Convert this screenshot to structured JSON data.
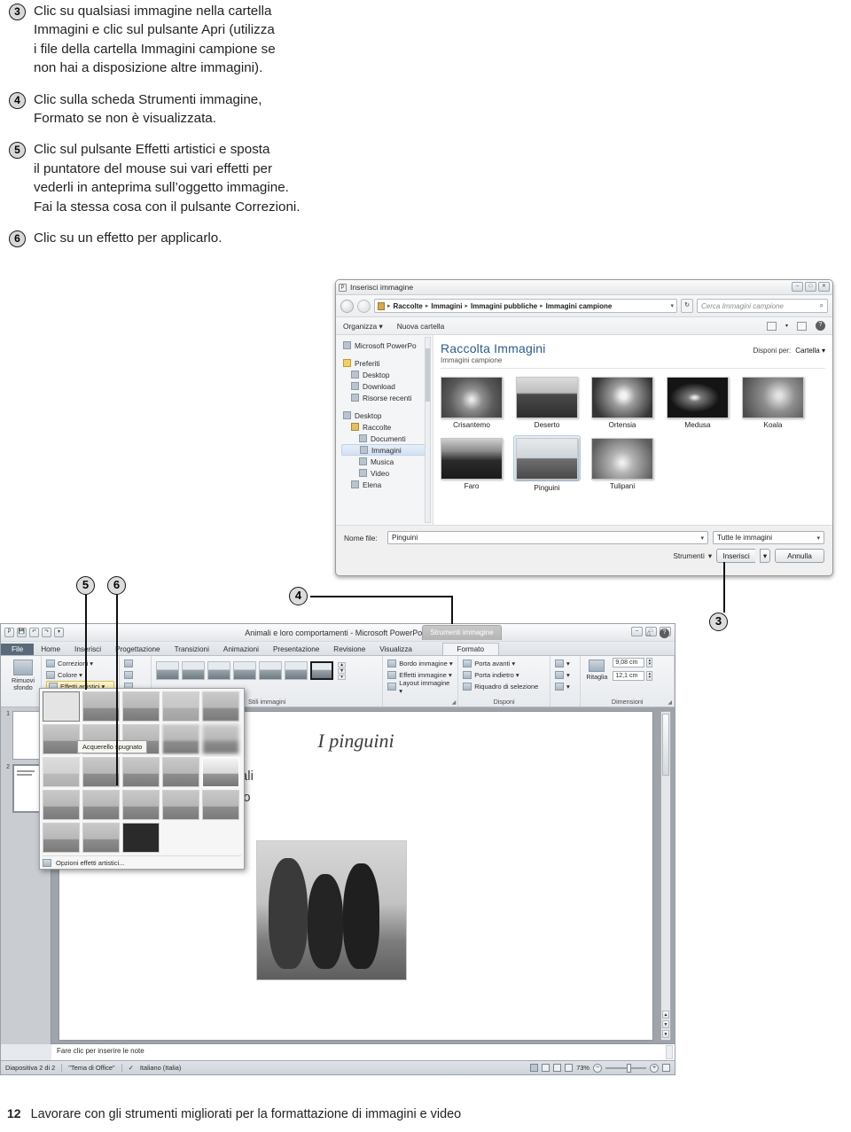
{
  "instructions": [
    {
      "num": "3",
      "lines": [
        "Clic su qualsiasi immagine nella cartella",
        "Immagini e clic sul pulsante Apri (utilizza",
        "i file della cartella Immagini campione se",
        "non hai a disposizione altre immagini)."
      ]
    },
    {
      "num": "4",
      "lines": [
        "Clic sulla scheda Strumenti immagine,",
        "Formato se non è visualizzata."
      ]
    },
    {
      "num": "5",
      "lines": [
        "Clic sul pulsante Effetti artistici e sposta",
        "il puntatore del mouse sui vari effetti per",
        "vederli in anteprima sull’oggetto immagine.",
        "Fai la stessa cosa con il pulsante Correzioni."
      ]
    },
    {
      "num": "6",
      "lines": [
        "Clic su un effetto per applicarlo."
      ]
    }
  ],
  "callouts": {
    "three": "3",
    "four": "4",
    "five": "5",
    "six": "6"
  },
  "dialog": {
    "title": "Inserisci immagine",
    "app_badge": "P",
    "window_buttons": {
      "minimize": "–",
      "maximize": "□",
      "close": "✕"
    },
    "breadcrumb": {
      "separator": "▸",
      "parts": [
        "Raccolte",
        "Immagini",
        "Immagini pubbliche",
        "Immagini campione"
      ],
      "caret": "▾"
    },
    "refresh_label": "↻",
    "search_placeholder": "Cerca Immagini campione",
    "search_icon": "⌕",
    "commandbar": {
      "organize": "Organizza ▾",
      "new_folder": "Nuova cartella",
      "help": "?"
    },
    "nav_items": [
      {
        "label": "Microsoft PowerPo",
        "icon": "app-icon",
        "indent": 0,
        "selected": false,
        "gap": false
      },
      {
        "label": "Preferiti",
        "icon": "star-icon",
        "indent": 0,
        "selected": false,
        "gap": true
      },
      {
        "label": "Desktop",
        "icon": "desktop-icon",
        "indent": 1,
        "selected": false,
        "gap": false
      },
      {
        "label": "Download",
        "icon": "download-icon",
        "indent": 1,
        "selected": false,
        "gap": false
      },
      {
        "label": "Risorse recenti",
        "icon": "recent-icon",
        "indent": 1,
        "selected": false,
        "gap": false
      },
      {
        "label": "Desktop",
        "icon": "desktop-icon",
        "indent": 0,
        "selected": false,
        "gap": true
      },
      {
        "label": "Raccolte",
        "icon": "library-icon",
        "indent": 1,
        "selected": false,
        "gap": false
      },
      {
        "label": "Documenti",
        "icon": "documents-icon",
        "indent": 2,
        "selected": false,
        "gap": false
      },
      {
        "label": "Immagini",
        "icon": "pictures-icon",
        "indent": 2,
        "selected": true,
        "gap": false
      },
      {
        "label": "Musica",
        "icon": "music-icon",
        "indent": 2,
        "selected": false,
        "gap": false
      },
      {
        "label": "Video",
        "icon": "video-icon",
        "indent": 2,
        "selected": false,
        "gap": false
      },
      {
        "label": "Elena",
        "icon": "user-icon",
        "indent": 1,
        "selected": false,
        "gap": false
      }
    ],
    "library": {
      "title": "Raccolta Immagini",
      "subtitle": "Immagini campione",
      "arrange_label": "Disponi per:",
      "arrange_value": "Cartella ▾"
    },
    "files": [
      {
        "name": "Crisantemo",
        "selected": false
      },
      {
        "name": "Deserto",
        "selected": false
      },
      {
        "name": "Ortensia",
        "selected": false
      },
      {
        "name": "Medusa",
        "selected": false
      },
      {
        "name": "Koala",
        "selected": false
      },
      {
        "name": "Faro",
        "selected": false
      },
      {
        "name": "Pinguini",
        "selected": true
      },
      {
        "name": "Tulipani",
        "selected": false
      }
    ],
    "footer": {
      "filename_label": "Nome file:",
      "filename_value": "Pinguini",
      "filetype_value": "Tutte le immagini",
      "tools_label": "Strumenti",
      "insert_label": "Inserisci",
      "cancel_label": "Annulla",
      "caret": "▾"
    }
  },
  "powerpoint": {
    "document_title": "Animali e loro comportamenti - Microsoft PowerPoint",
    "app_badge": "P",
    "quick_access": [
      "save-icon",
      "undo-icon",
      "redo-icon",
      "customize-icon"
    ],
    "window_buttons": {
      "minimize": "–",
      "restore": "□",
      "close": "✕"
    },
    "contextual_tab_title": "Strumenti immagine",
    "tabs": [
      "File",
      "Home",
      "Inserisci",
      "Progettazione",
      "Transizioni",
      "Animazioni",
      "Presentazione",
      "Revisione",
      "Visualizza"
    ],
    "contextual_tab": "Formato",
    "ribbon": {
      "remove_background": [
        "Rimuovi",
        "sfondo"
      ],
      "adjust_buttons": [
        "Correzioni ▾",
        "Colore ▾",
        "Effetti artistici ▾"
      ],
      "styles_group": "Stili immagini",
      "style_count": 7,
      "selected_style": 6,
      "picture_commands": [
        "Bordo immagine ▾",
        "Effetti immagine ▾",
        "Layout immagine ▾"
      ],
      "arrange_commands": [
        "Porta avanti ▾",
        "Porta indietro ▾",
        "Riquadro di selezione"
      ],
      "arrange_group": "Disponi",
      "crop_label": "Ritaglia",
      "height_value": "9,08 cm",
      "width_value": "12,1 cm",
      "size_group": "Dimensioni"
    },
    "artistic_gallery": {
      "rows": [
        5,
        5,
        5,
        5,
        3
      ],
      "selected_index": 0,
      "hover_index": 11,
      "tooltip": "Acquerello spugnato",
      "options_label": "Opzioni effetti artistici..."
    },
    "slide": {
      "title": "I pinguini",
      "bullet_1": "portamenti individuali",
      "bullet_2": "portamenti di gruppo"
    },
    "slides_panel": [
      {
        "number": "1",
        "selected": false
      },
      {
        "number": "2",
        "selected": true
      }
    ],
    "notes_placeholder": "Fare clic per inserire le note",
    "status": {
      "slide_counter": "Diapositiva 2 di 2",
      "theme": "\"Tema di Office\"",
      "language": "Italiano (Italia)",
      "zoom": "73%",
      "zoom_out": "−",
      "zoom_in": "+",
      "fit_icon": "fit-slide-icon"
    }
  },
  "page": {
    "number": "12",
    "footer_text": "Lavorare con gli strumenti migliorati per la formattazione di immagini e video"
  }
}
